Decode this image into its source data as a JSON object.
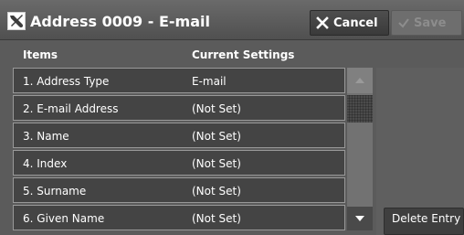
{
  "window": {
    "title": "Address 0009 - E-mail"
  },
  "toolbar": {
    "cancel_label": "Cancel",
    "save_label": "Save"
  },
  "table": {
    "headers": {
      "items": "Items",
      "current": "Current Settings"
    },
    "rows": [
      {
        "item": "1.   Address Type",
        "value": "E-mail"
      },
      {
        "item": "2.   E-mail Address",
        "value": "(Not Set)"
      },
      {
        "item": "3.   Name",
        "value": "(Not Set)"
      },
      {
        "item": "4.   Index",
        "value": "(Not Set)"
      },
      {
        "item": "5.   Surname",
        "value": "(Not Set)"
      },
      {
        "item": "6.   Given Name",
        "value": "(Not Set)"
      }
    ]
  },
  "side": {
    "delete_label": "Delete Entry"
  },
  "icons": {
    "title": "address-book-tools-icon",
    "cancel": "close-x-icon",
    "save": "checkmark-icon",
    "scroll_up": "arrow-up-icon",
    "scroll_down": "arrow-down-icon"
  }
}
